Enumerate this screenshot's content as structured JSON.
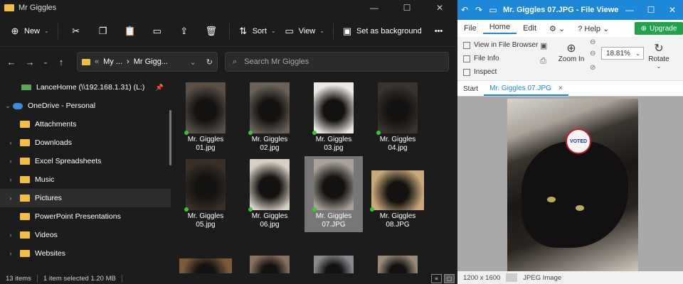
{
  "explorer": {
    "title": "Mr Giggles",
    "commands": {
      "new": "New",
      "sort": "Sort",
      "view": "View",
      "background": "Set as background",
      "more": "•••"
    },
    "address": {
      "prefix": "«",
      "seg1": "My ...",
      "sep": "›",
      "seg2": "Mr Gigg...",
      "chevron": "⌄"
    },
    "search_placeholder": "Search Mr Giggles",
    "sidebar": [
      {
        "label": "LanceHome (\\\\192.168.1.31) (L:)",
        "icon": "network-drive-icon",
        "chevron": "",
        "pinned": true
      },
      {
        "label": "OneDrive - Personal",
        "icon": "onedrive-icon",
        "chevron": "⌄"
      },
      {
        "label": "Attachments",
        "icon": "folder-icon",
        "chevron": ""
      },
      {
        "label": "Downloads",
        "icon": "folder-icon",
        "chevron": "›"
      },
      {
        "label": "Excel Spreadsheets",
        "icon": "folder-icon",
        "chevron": "›"
      },
      {
        "label": "Music",
        "icon": "folder-icon",
        "chevron": "›"
      },
      {
        "label": "Pictures",
        "icon": "folder-icon",
        "chevron": "›",
        "selected": true
      },
      {
        "label": "PowerPoint Presentations",
        "icon": "folder-icon",
        "chevron": ""
      },
      {
        "label": "Videos",
        "icon": "folder-icon",
        "chevron": "›"
      },
      {
        "label": "Websites",
        "icon": "folder-icon",
        "chevron": "›"
      }
    ],
    "files": [
      {
        "line1": "Mr. Giggles",
        "line2": "01.jpg"
      },
      {
        "line1": "Mr. Giggles",
        "line2": "02.jpg"
      },
      {
        "line1": "Mr. Giggles",
        "line2": "03.jpg"
      },
      {
        "line1": "Mr. Giggles",
        "line2": "04.jpg"
      },
      {
        "line1": "Mr. Giggles",
        "line2": "05.jpg"
      },
      {
        "line1": "Mr. Giggles",
        "line2": "06.jpg"
      },
      {
        "line1": "Mr. Giggles",
        "line2": "07.JPG",
        "selected": true
      },
      {
        "line1": "Mr. Giggles",
        "line2": "08.JPG"
      },
      {
        "line1": "",
        "line2": ""
      },
      {
        "line1": "",
        "line2": ""
      },
      {
        "line1": "",
        "line2": ""
      },
      {
        "line1": "",
        "line2": ""
      }
    ],
    "status": {
      "count": "13 items",
      "selection": "1 item selected  1.20 MB"
    }
  },
  "viewer": {
    "title": "Mr. Giggles 07.JPG - File Viewer ...",
    "menu": {
      "file": "File",
      "home": "Home",
      "edit": "Edit",
      "help": "Help",
      "upgrade": "Upgrade"
    },
    "ribbon": {
      "view_in_browser": "View in File Browser",
      "file_info": "File Info",
      "inspect": "Inspect",
      "zoom_in": "Zoom In",
      "zoom_value": "18.81%",
      "rotate": "Rotate"
    },
    "tabs": {
      "start": "Start",
      "file": "Mr. Giggles 07.JPG",
      "close": "×"
    },
    "sticker_text": "VOTED",
    "status": {
      "dimensions": "1200 x 1600",
      "type": "JPEG Image"
    }
  }
}
